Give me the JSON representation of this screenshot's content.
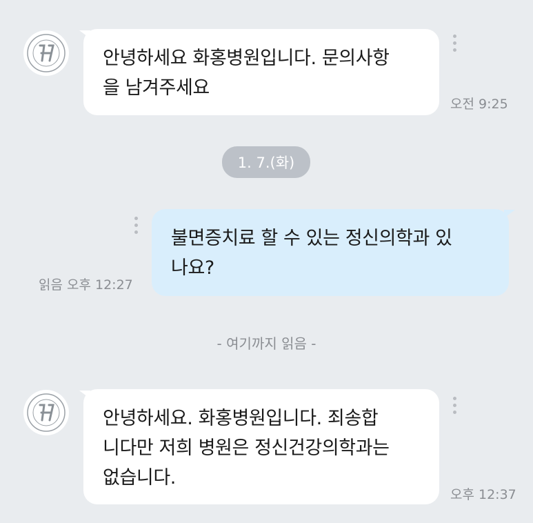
{
  "messages": [
    {
      "direction": "incoming",
      "sender_avatar_label": "Hwahong Hospital",
      "lines": [
        "안녕하세요 화홍병원입니다. 문의사항",
        "을 남겨주세요"
      ],
      "time": "오전 9:25"
    },
    {
      "direction": "outgoing",
      "lines": [
        "불면증치료 할 수 있는 정신의학과 있",
        "나요?"
      ],
      "status": "읽음 오후 12:27"
    },
    {
      "direction": "incoming",
      "sender_avatar_label": "Hwahong Hospital",
      "lines": [
        "안녕하세요. 화홍병원입니다. 죄송합",
        "니다만 저희 병원은 정신건강의학과는",
        "없습니다."
      ],
      "time": "오후 12:37"
    }
  ],
  "date_separator": "1. 7.(화)",
  "read_marker": "- 여기까지 읽음 -",
  "colors": {
    "background": "#e9ecef",
    "incoming_bubble": "#ffffff",
    "outgoing_bubble": "#d9eefc",
    "date_pill": "#bcc1c8",
    "meta_text": "#8a8d92"
  }
}
